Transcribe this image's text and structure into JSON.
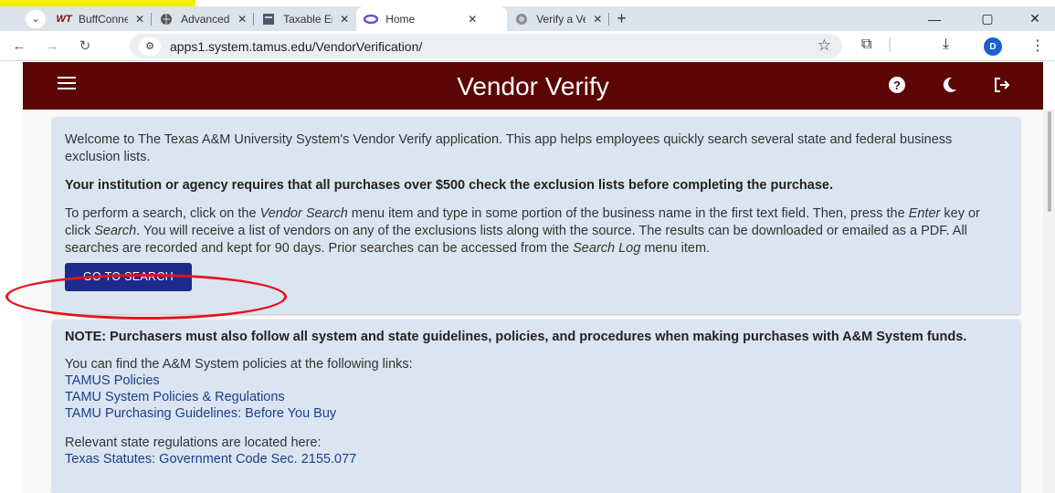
{
  "browser": {
    "tabs": [
      {
        "label": "BuffConne",
        "icon": "wt-icon"
      },
      {
        "label": "Advanced",
        "icon": "globe-icon"
      },
      {
        "label": "Taxable Er",
        "icon": "page-icon"
      },
      {
        "label": "Home",
        "icon": "app-swirl-icon"
      },
      {
        "label": "Verify a Ve",
        "icon": "seal-icon"
      }
    ],
    "active_tab": 3,
    "url": "apps1.system.tamus.edu/VendorVerification/",
    "avatar_letter": "D",
    "colors": {
      "tab_bar": "#dde3ea",
      "avatar": "#1a5fcf"
    }
  },
  "app": {
    "title": "Vendor Verify",
    "header_color": "#5c0505",
    "header_icons": [
      "menu-icon",
      "help-icon",
      "dark-mode-icon",
      "logout-icon"
    ]
  },
  "intro": {
    "welcome": "Welcome to The Texas A&M University System's Vendor Verify application. This app helps employees quickly search several state and federal business exclusion lists.",
    "requirement": "Your institution or agency requires that all purchases over $500 check the exclusion lists before completing the purchase.",
    "instructions_1": "To perform a search, click on the ",
    "instructions_vendor_search": "Vendor Search",
    "instructions_2": " menu item and type in some portion of the business name in the first text field. Then, press the ",
    "instructions_enter": "Enter",
    "instructions_3": " key or click ",
    "instructions_search": "Search",
    "instructions_4": ". You will receive a list of vendors on any of the exclusions lists along with the source. The results can be downloaded or emailed as a PDF. All searches are recorded and kept for 90 days. Prior searches can be accessed from the ",
    "instructions_search_log": "Search Log",
    "instructions_5": " menu item.",
    "button": "GO TO SEARCH"
  },
  "note": {
    "heading": "NOTE: Purchasers must also follow all system and state guidelines, policies, and procedures when making purchases with A&M System funds.",
    "links_intro": "You can find the A&M System policies at the following links:",
    "links": [
      "TAMUS Policies",
      "TAMU System Policies & Regulations",
      "TAMU Purchasing Guidelines: Before You Buy"
    ],
    "state_intro": "Relevant state regulations are located here:",
    "state_links": [
      "Texas Statutes: Government Code Sec. 2155.077"
    ]
  }
}
